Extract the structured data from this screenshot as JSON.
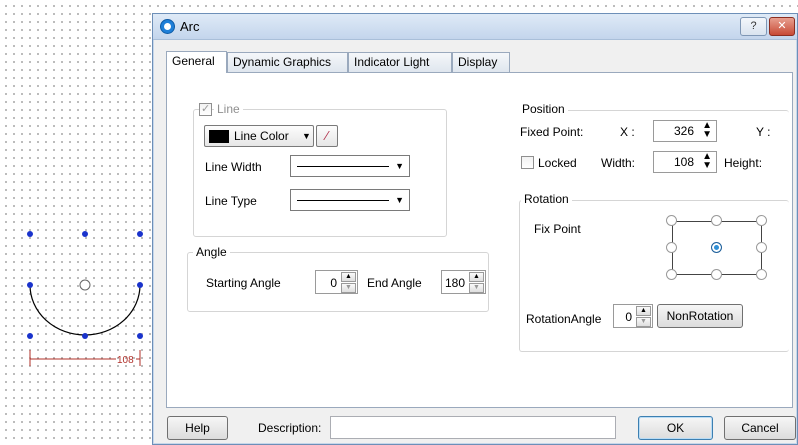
{
  "dialog": {
    "title": "Arc",
    "help_glyph": "?",
    "close_glyph": "✕",
    "tabs": [
      {
        "label": "General"
      },
      {
        "label": "Dynamic Graphics"
      },
      {
        "label": "Indicator Light"
      },
      {
        "label": "Display"
      }
    ]
  },
  "line": {
    "checkbox_label": "Line",
    "checked": true,
    "color_label": "Line Color",
    "color_value": "#000000",
    "width_label": "Line Width",
    "type_label": "Line Type"
  },
  "angle": {
    "title": "Angle",
    "start_label": "Starting Angle",
    "start_value": "0",
    "end_label": "End Angle",
    "end_value": "180"
  },
  "position": {
    "title": "Position",
    "fixed_point_label": "Fixed Point:",
    "x_label": "X :",
    "x_value": "326",
    "y_label": "Y :",
    "locked_label": "Locked",
    "width_label": "Width:",
    "width_value": "108",
    "height_label": "Height:"
  },
  "rotation": {
    "title": "Rotation",
    "fix_point_label": "Fix Point",
    "angle_label": "RotationAngle",
    "angle_value": "0",
    "nonrotation_label": "NonRotation"
  },
  "footer": {
    "help_label": "Help",
    "description_label": "Description:",
    "description_value": "",
    "ok_label": "OK",
    "cancel_label": "Cancel"
  },
  "canvas": {
    "dimension_label": "108",
    "handle_color": "#1a33cc",
    "dimension_color": "#b0302a"
  }
}
